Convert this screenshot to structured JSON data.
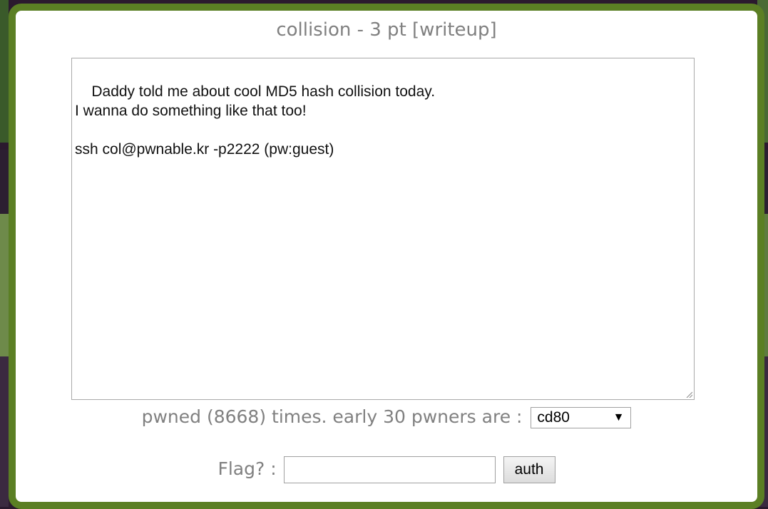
{
  "title": {
    "name": "collision - 3 pt",
    "writeup_link": "[writeup]"
  },
  "description": "Daddy told me about cool MD5 hash collision today.\nI wanna do something like that too!\n\nssh col@pwnable.kr -p2222 (pw:guest)",
  "stats": {
    "pwned_text": "pwned (8668) times. early 30 pwners are :",
    "pwners_selected": "cd80"
  },
  "flag_form": {
    "label": "Flag? :",
    "input_value": "",
    "submit_label": "auth"
  },
  "colors": {
    "modal_border": "#5b7f24",
    "title_text": "#808080",
    "background": "#2b1a2e"
  },
  "icons": {
    "dropdown": "chevron-down-icon",
    "resize": "resize-grip-icon"
  }
}
